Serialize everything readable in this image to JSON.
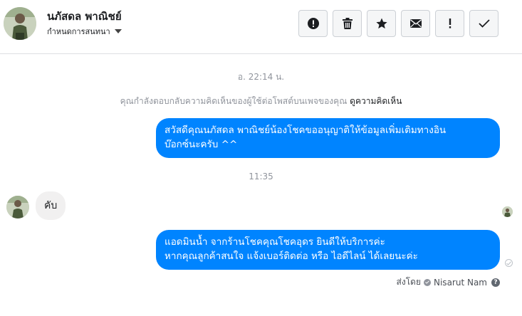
{
  "header": {
    "contact_name": "นภัสดล พาณิชย์",
    "assign_label": "กำหนดการสนทนา",
    "actions": [
      {
        "id": "spam",
        "icon": "alert-circle-icon"
      },
      {
        "id": "delete",
        "icon": "trash-icon"
      },
      {
        "id": "star",
        "icon": "star-icon"
      },
      {
        "id": "unread",
        "icon": "envelope-icon"
      },
      {
        "id": "follow-up",
        "icon": "exclamation-icon"
      },
      {
        "id": "done",
        "icon": "check-icon"
      }
    ]
  },
  "conversation": {
    "timestamp_1": "อ. 22:14 น.",
    "notice_text": "คุณกำลังตอบกลับความคิดเห็นของผู้ใช้ต่อโพสต์บนเพจของคุณ ",
    "notice_link": "ดูความคิดเห็น",
    "message_1": [
      "สวัสดีคุณนภัสดล พาณิชย์น้องโชคขออนุญาติให้ข้อมูลเพิ่มเติมทางอิน",
      "บ๊อกซ์นะครับ ^^"
    ],
    "timestamp_2": "11:35",
    "reply": "คับ",
    "message_2": [
      "แอดมินน้ำ จากร้านโชคคุณโชคอุดร ยินดีให้บริการค่ะ",
      "หากคุณลูกค้าสนใจ แจ้งเบอร์ติดต่อ หรือ ไอดีไลน์ ได้เลยนะค่ะ"
    ],
    "sent_by_label": "ส่งโดย",
    "sent_by_name": "Nisarut Nam"
  },
  "colors": {
    "bubble_out": "#0084ff",
    "bubble_in": "#f1f0f0",
    "meta_text": "#90949c"
  }
}
